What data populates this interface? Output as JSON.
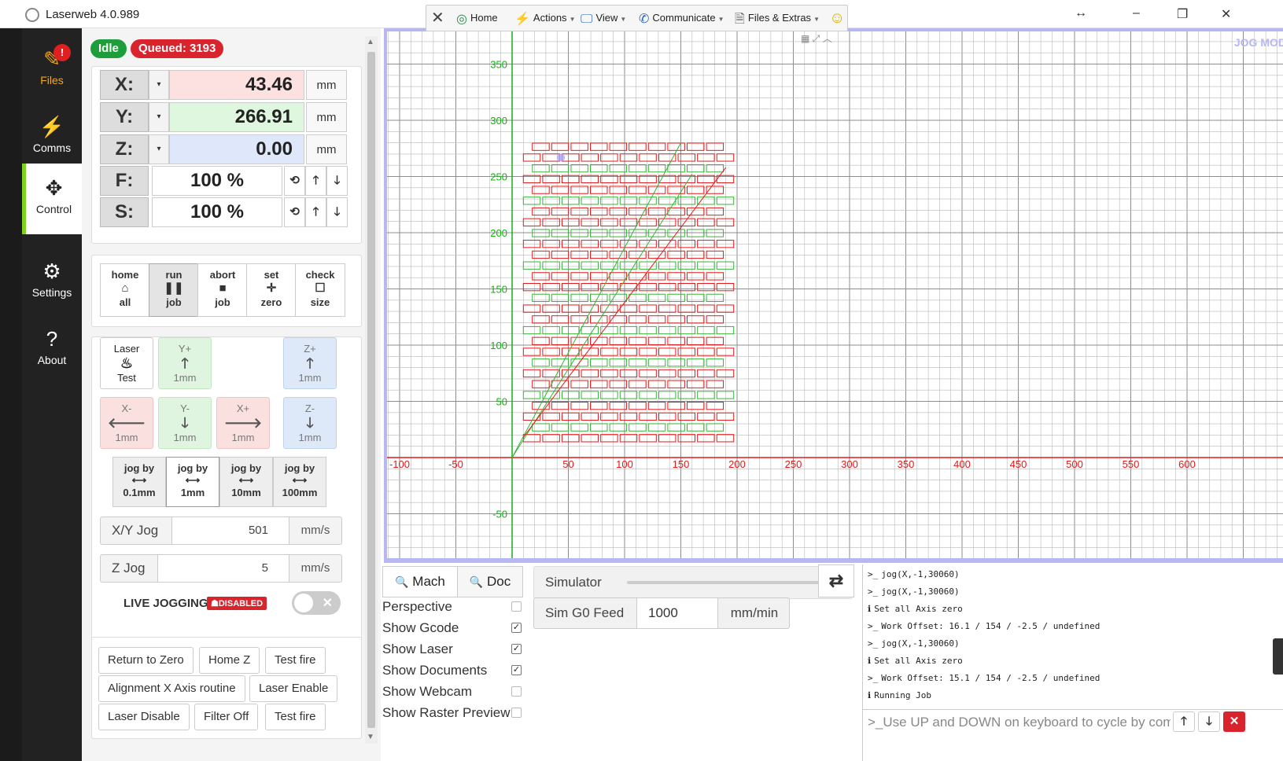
{
  "window": {
    "title": "Laserweb 4.0.989",
    "controls": [
      "↔",
      "–",
      "❐",
      "✕"
    ]
  },
  "sidenav": {
    "items": [
      {
        "label": "Files",
        "icon": "✎",
        "warn": "!"
      },
      {
        "label": "Comms",
        "icon": "⚡"
      },
      {
        "label": "Control",
        "icon": "✥"
      },
      {
        "label": "Settings",
        "icon": "⚙"
      },
      {
        "label": "About",
        "icon": "?"
      }
    ]
  },
  "status": {
    "state": "Idle",
    "queued": "Queued: 3193"
  },
  "dro": {
    "x": {
      "label": "X:",
      "value": "43.46",
      "unit": "mm"
    },
    "y": {
      "label": "Y:",
      "value": "266.91",
      "unit": "mm"
    },
    "z": {
      "label": "Z:",
      "value": "0.00",
      "unit": "mm"
    },
    "f": {
      "label": "F:",
      "value": "100 %"
    },
    "s": {
      "label": "S:",
      "value": "100 %"
    },
    "dropdown_icon": "▾",
    "reset_icon": "⟲",
    "up_icon": "🡑",
    "down_icon": "🡓"
  },
  "job_buttons": [
    {
      "top": "home",
      "icon": "⌂",
      "bottom": "all"
    },
    {
      "top": "run",
      "icon": "❚❚",
      "bottom": "job"
    },
    {
      "top": "abort",
      "icon": "■",
      "bottom": "job"
    },
    {
      "top": "set",
      "icon": "✛",
      "bottom": "zero"
    },
    {
      "top": "check",
      "icon": "☐",
      "bottom": "size"
    }
  ],
  "jog": {
    "laser_test": {
      "top": "Laser",
      "icon": "♨",
      "bottom": "Test"
    },
    "y_plus": {
      "top": "Y+",
      "icon": "🡑",
      "bottom": "1mm"
    },
    "z_plus": {
      "top": "Z+",
      "icon": "🡑",
      "bottom": "1mm"
    },
    "x_minus": {
      "top": "X-",
      "icon": "🡐",
      "bottom": "1mm"
    },
    "y_minus": {
      "top": "Y-",
      "icon": "🡓",
      "bottom": "1mm"
    },
    "x_plus": {
      "top": "X+",
      "icon": "🡒",
      "bottom": "1mm"
    },
    "z_minus": {
      "top": "Z-",
      "icon": "🡓",
      "bottom": "1mm"
    },
    "steps": [
      {
        "top": "jog by",
        "icon": "⟷",
        "bottom": "0.1mm"
      },
      {
        "top": "jog by",
        "icon": "⟷",
        "bottom": "1mm"
      },
      {
        "top": "jog by",
        "icon": "⟷",
        "bottom": "10mm"
      },
      {
        "top": "jog by",
        "icon": "⟷",
        "bottom": "100mm"
      }
    ],
    "xy_jog": {
      "label": "X/Y Jog",
      "value": "501",
      "unit": "mm/s"
    },
    "z_jog": {
      "label": "Z Jog",
      "value": "5",
      "unit": "mm/s"
    },
    "live_jogging": "LIVE JOGGING",
    "live_disabled": "☗DISABLED",
    "toggle_x": "✕"
  },
  "macros": [
    "Return to Zero",
    "Home Z",
    "Test fire",
    "Alignment X Axis routine",
    "Laser Enable",
    "Laser Disable",
    "Filter Off",
    "Test fire"
  ],
  "toolbar": {
    "close": "✕",
    "home": "Home",
    "actions": "Actions",
    "view": "View",
    "communicate": "Communicate",
    "files_extras": "Files & Extras",
    "smiley": "☺",
    "mini": "▦ ⤢ ︿"
  },
  "canvas": {
    "jog_mode": "JOG MOD",
    "x_ticks": [
      "-100",
      "-50",
      "50",
      "100",
      "150",
      "200",
      "250",
      "300",
      "350",
      "400",
      "450",
      "500",
      "550",
      "600"
    ],
    "y_ticks": [
      "350",
      "300",
      "250",
      "200",
      "150",
      "100",
      "50",
      "-50"
    ],
    "colors": {
      "x_axis": "#e31a1a",
      "y_axis": "#12b012",
      "grid": "#b9b9b9",
      "grid_major": "#8d8d8d",
      "gcode": "#e31a1a"
    }
  },
  "view_tabs": {
    "mach": "Mach",
    "doc": "Doc",
    "search_icon": "🔍"
  },
  "view_options": [
    {
      "label": "Perspective",
      "checked": false
    },
    {
      "label": "Show Gcode",
      "checked": true
    },
    {
      "label": "Show Laser",
      "checked": true
    },
    {
      "label": "Show Documents",
      "checked": true
    },
    {
      "label": "Show Webcam",
      "checked": false
    },
    {
      "label": "Show Raster Preview",
      "checked": false
    }
  ],
  "simulator": {
    "label": "Simulator",
    "swap_icon": "⇄",
    "g0_label": "Sim G0 Feed",
    "g0_value": "1000",
    "g0_unit": "mm/min"
  },
  "console": {
    "lines": [
      {
        "prefix": ">_",
        "text": "jog(X,-1,30060)"
      },
      {
        "prefix": ">_",
        "text": "jog(X,-1,30060)"
      },
      {
        "prefix": "ℹ",
        "text": "Set all Axis zero"
      },
      {
        "prefix": ">_",
        "text": "Work Offset: 16.1 / 154 / -2.5 / undefined"
      },
      {
        "prefix": ">_",
        "text": "jog(X,-1,30060)"
      },
      {
        "prefix": "ℹ",
        "text": "Set all Axis zero"
      },
      {
        "prefix": ">_",
        "text": "Work Offset: 15.1 / 154 / -2.5 / undefined"
      },
      {
        "prefix": "ℹ",
        "text": "Running Job"
      }
    ],
    "input_prompt": ">_",
    "placeholder": "Use UP and DOWN on keyboard to cycle by com",
    "up": "🡑",
    "down": "🡓",
    "clear": "✕"
  }
}
